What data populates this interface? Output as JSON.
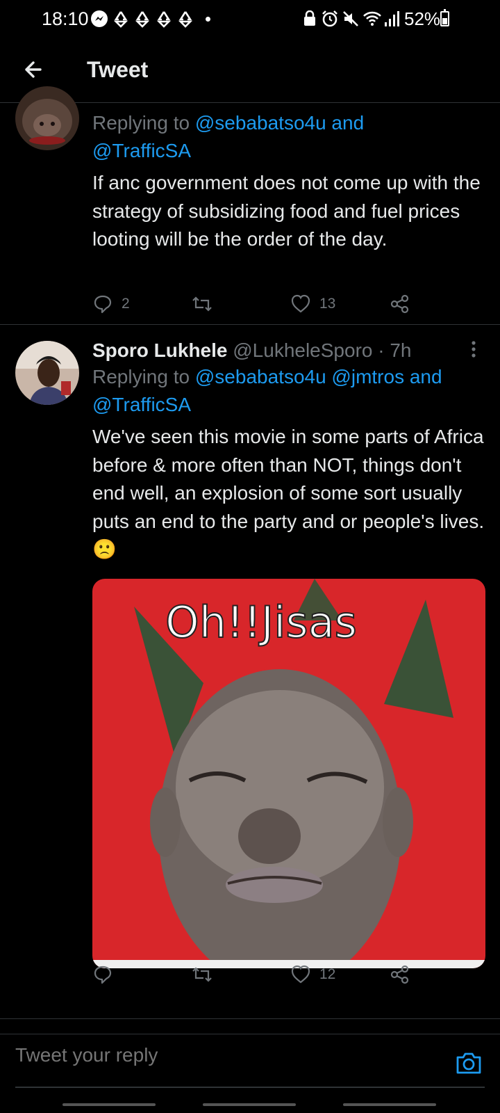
{
  "status_bar": {
    "time": "18:10",
    "battery": "52%",
    "icons": [
      "messenger-icon",
      "recycle-icon",
      "recycle-icon",
      "recycle-icon",
      "recycle-icon",
      "alarm-icon",
      "mute-icon",
      "wifi-icon",
      "signal-icon",
      "battery-icon"
    ]
  },
  "header": {
    "title": "Tweet",
    "back_icon": "arrow-left-icon"
  },
  "tweets": [
    {
      "reply_prefix": "Replying to ",
      "mentions_line1": "@sebabatso4u and",
      "mentions_line2": "@TrafficSA",
      "text": "If anc  government does not come up with the strategy of subsidizing  food and fuel prices looting will be the order of the day.",
      "replies": "2",
      "retweets": "",
      "likes": "13"
    },
    {
      "author_name": "Sporo Lukhele",
      "author_handle": "@LukheleSporo · 7h",
      "reply_prefix": "Replying to ",
      "mentions_line1": "@sebabatso4u @jmtros and",
      "mentions_line2": "@TrafficSA",
      "text": "We've seen this movie in some parts of Africa before & more often than NOT, things don't end well, an explosion of some sort usually puts an end to the party and or people's lives.",
      "emoji": "🙁",
      "media_caption": "Oh!!Jisas",
      "replies": "",
      "retweets": "",
      "likes": "12"
    }
  ],
  "composer": {
    "placeholder": "Tweet your reply",
    "camera_icon": "camera-icon"
  },
  "colors": {
    "background": "#000000",
    "accent": "#1d9bf0",
    "muted": "#71767b",
    "text": "#e7e9ea",
    "media_bg": "#d8262a"
  }
}
